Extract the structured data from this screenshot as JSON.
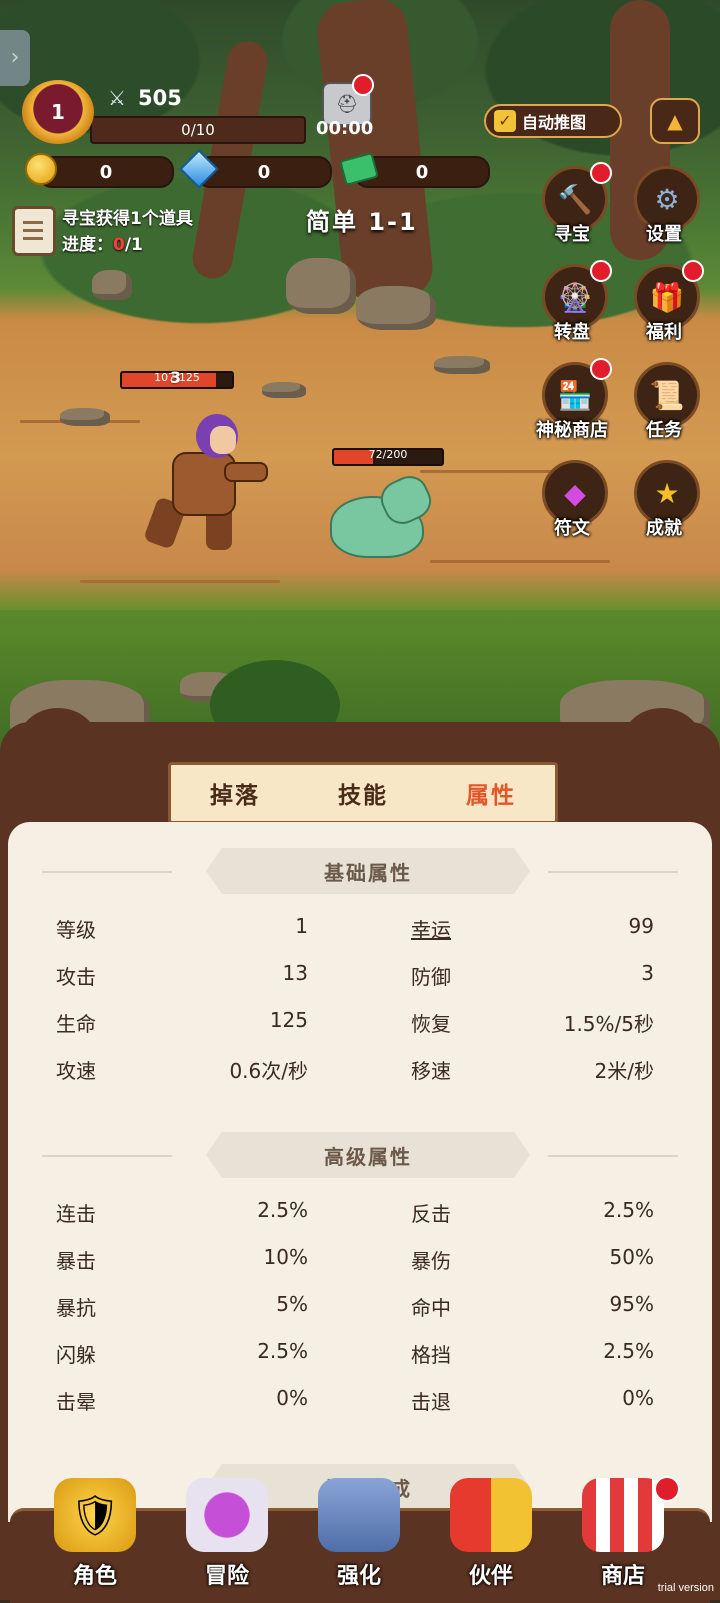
{
  "hud": {
    "level": "1",
    "power": "505",
    "xp": "0/10",
    "timer": "00:00",
    "auto_label": "自动推图",
    "gold": "0",
    "diamond": "0",
    "cash": "0"
  },
  "quest": {
    "title": "寻宝获得1个道具",
    "progress_label": "进度：",
    "progress_current": "0",
    "progress_total": "/1"
  },
  "stage": "简单 1-1",
  "side_menu": [
    {
      "label": "寻宝",
      "icon": "hammer-icon"
    },
    {
      "label": "设置",
      "icon": "gear-icon"
    },
    {
      "label": "转盘",
      "icon": "wheel-icon"
    },
    {
      "label": "福利",
      "icon": "gift-icon"
    },
    {
      "label": "神秘商店",
      "icon": "shop-icon"
    },
    {
      "label": "任务",
      "icon": "scroll-icon"
    },
    {
      "label": "符文",
      "icon": "rune-gem-icon"
    },
    {
      "label": "成就",
      "icon": "star-icon"
    }
  ],
  "battle": {
    "hero_hp": "107/125",
    "hero_hp_ratio": 0.856,
    "damage_number": "3",
    "enemy_hp": "72/200",
    "enemy_hp_ratio": 0.36
  },
  "tabs": [
    "掉落",
    "技能",
    "属性"
  ],
  "active_tab": 2,
  "sections": {
    "basic_title": "基础属性",
    "advanced_title": "高级属性",
    "effect_title": "效果加成"
  },
  "basic_attrs": [
    {
      "k1": "等级",
      "v1": "1",
      "k2": "幸运",
      "v2": "99"
    },
    {
      "k1": "攻击",
      "v1": "13",
      "k2": "防御",
      "v2": "3"
    },
    {
      "k1": "生命",
      "v1": "125",
      "k2": "恢复",
      "v2": "1.5%/5秒"
    },
    {
      "k1": "攻速",
      "v1": "0.6次/秒",
      "k2": "移速",
      "v2": "2米/秒"
    }
  ],
  "advanced_attrs": [
    {
      "k1": "连击",
      "v1": "2.5%",
      "k2": "反击",
      "v2": "2.5%"
    },
    {
      "k1": "暴击",
      "v1": "10%",
      "k2": "暴伤",
      "v2": "50%"
    },
    {
      "k1": "暴抗",
      "v1": "5%",
      "k2": "命中",
      "v2": "95%"
    },
    {
      "k1": "闪躲",
      "v1": "2.5%",
      "k2": "格挡",
      "v2": "2.5%"
    },
    {
      "k1": "击晕",
      "v1": "0%",
      "k2": "击退",
      "v2": "0%"
    }
  ],
  "bottom_nav": [
    {
      "label": "角色",
      "icon": "armor-icon"
    },
    {
      "label": "冒险",
      "icon": "portal-icon"
    },
    {
      "label": "强化",
      "icon": "anvil-icon"
    },
    {
      "label": "伙伴",
      "icon": "companions-icon"
    },
    {
      "label": "商店",
      "icon": "store-icon"
    }
  ],
  "watermark": "trial version",
  "colors": {
    "accent": "#e2572a",
    "panel": "#5a3322",
    "content_bg": "#f5efe4",
    "notify": "#e11d2b"
  }
}
